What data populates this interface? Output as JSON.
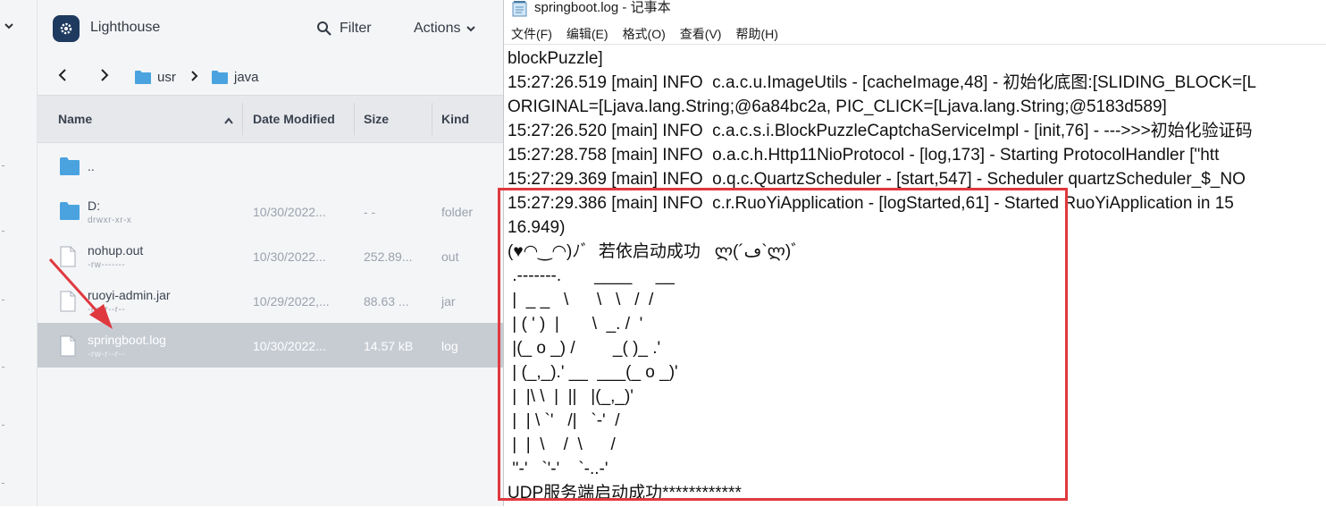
{
  "file_manager": {
    "app_name": "Lighthouse",
    "filter_label": "Filter",
    "actions_label": "Actions",
    "breadcrumb": [
      "usr",
      "java"
    ],
    "columns": {
      "name": "Name",
      "date": "Date Modified",
      "size": "Size",
      "kind": "Kind"
    },
    "rows": [
      {
        "name": "..",
        "perm": "",
        "date": "",
        "size": "",
        "kind": "",
        "type": "folder"
      },
      {
        "name": "D:",
        "perm": "drwxr-xr-x",
        "date": "10/30/2022...",
        "size": "- -",
        "kind": "folder",
        "type": "folder"
      },
      {
        "name": "nohup.out",
        "perm": "-rw-------",
        "date": "10/30/2022...",
        "size": "252.89...",
        "kind": "out",
        "type": "file"
      },
      {
        "name": "ruoyi-admin.jar",
        "perm": "-rw-r--r--",
        "date": "10/29/2022,...",
        "size": "88.63 ...",
        "kind": "jar",
        "type": "file"
      },
      {
        "name": "springboot.log",
        "perm": "-rw-r--r--",
        "date": "10/30/2022...",
        "size": "14.57 kB",
        "kind": "log",
        "type": "file",
        "selected": true
      }
    ]
  },
  "notepad": {
    "title": "springboot.log - 记事本",
    "menu": [
      "文件(F)",
      "编辑(E)",
      "格式(O)",
      "查看(V)",
      "帮助(H)"
    ],
    "lines": [
      "blockPuzzle]",
      "15:27:26.519 [main] INFO  c.a.c.u.ImageUtils - [cacheImage,48] - 初始化底图:[SLIDING_BLOCK=[L",
      "ORIGINAL=[Ljava.lang.String;@6a84bc2a, PIC_CLICK=[Ljava.lang.String;@5183d589]",
      "15:27:26.520 [main] INFO  c.a.c.s.i.BlockPuzzleCaptchaServiceImpl - [init,76] - --->>>初始化验证码",
      "15:27:28.758 [main] INFO  o.a.c.h.Http11NioProtocol - [log,173] - Starting ProtocolHandler [\"htt",
      "15:27:29.369 [main] INFO  o.q.c.QuartzScheduler - [start,547] - Scheduler quartzScheduler_$_NO",
      "15:27:29.386 [main] INFO  c.r.RuoYiApplication - [logStarted,61] - Started RuoYiApplication in 15",
      "16.949)",
      "(♥◠‿◠)ﾉﾞ  若依启动成功   ლ(´ڡ`ლ)ﾞ",
      " .-------.       ____     __",
      " |  _ _   \\      \\   \\   /  /",
      " | ( ' )  |       \\  _. /  '",
      " |(_ o _) /        _( )_ .'",
      " | (_,_).' __  ___(_ o _)'",
      " |  |\\ \\  |  ||   |(_,_)'",
      " |  | \\ `'   /|   `-'  /",
      " |  |  \\    /  \\      /",
      " ''-'   `'-'    `-..-'",
      "UDP服务端启动成功************"
    ]
  },
  "colors": {
    "highlight_box": "#e0383f",
    "arrow": "#e0383f",
    "selected_row": "#c7ccd3",
    "folder": "#4aa3df"
  }
}
